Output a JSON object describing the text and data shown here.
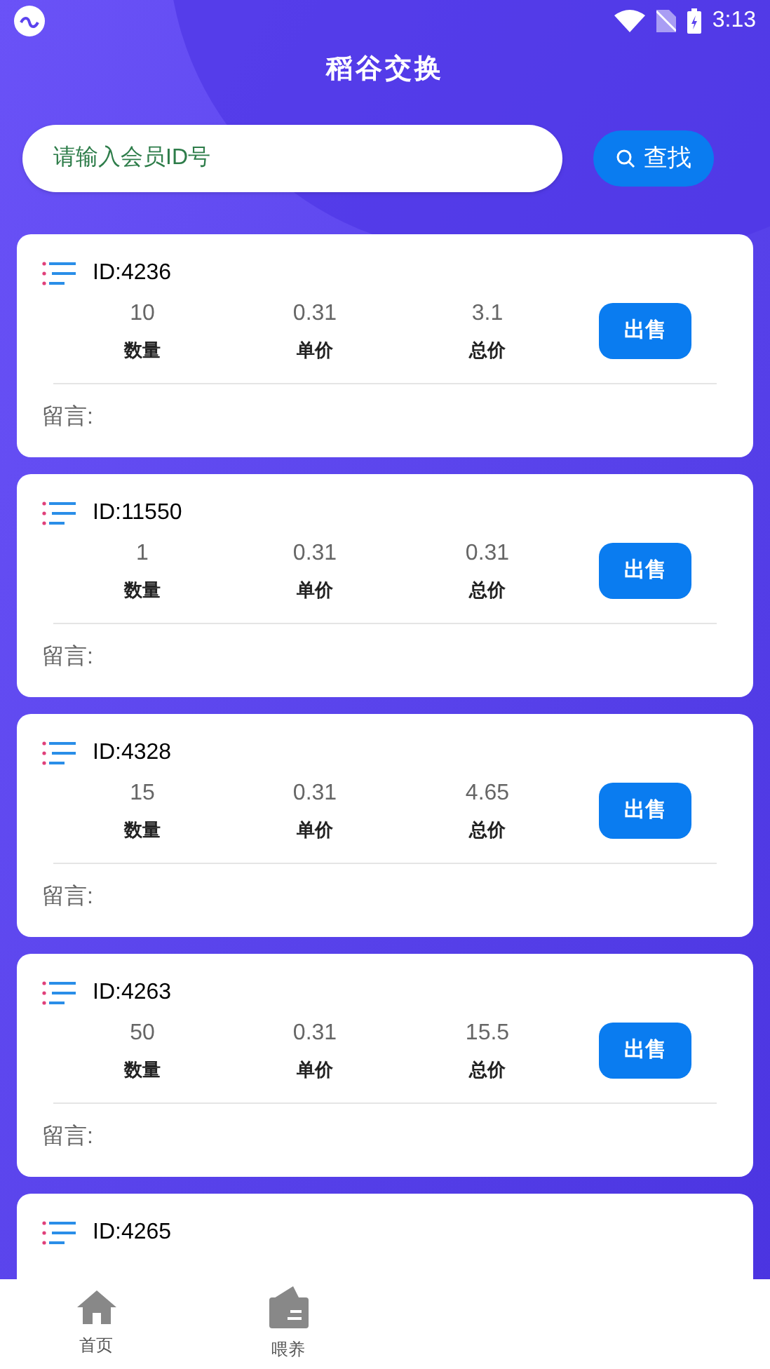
{
  "status_bar": {
    "time": "3:13"
  },
  "title": "稻谷交换",
  "search": {
    "placeholder": "请输入会员ID号",
    "button": "查找"
  },
  "orders": [
    {
      "id": "ID:4236",
      "quantity": "10",
      "unit_price": "0.31",
      "total": "3.1",
      "quantity_label": "数量",
      "unit_price_label": "单价",
      "total_label": "总价",
      "action": "出售",
      "message_label": "留言:"
    },
    {
      "id": "ID:11550",
      "quantity": "1",
      "unit_price": "0.31",
      "total": "0.31",
      "quantity_label": "数量",
      "unit_price_label": "单价",
      "total_label": "总价",
      "action": "出售",
      "message_label": "留言:"
    },
    {
      "id": "ID:4328",
      "quantity": "15",
      "unit_price": "0.31",
      "total": "4.65",
      "quantity_label": "数量",
      "unit_price_label": "单价",
      "total_label": "总价",
      "action": "出售",
      "message_label": "留言:"
    },
    {
      "id": "ID:4263",
      "quantity": "50",
      "unit_price": "0.31",
      "total": "15.5",
      "quantity_label": "数量",
      "unit_price_label": "单价",
      "total_label": "总价",
      "action": "出售",
      "message_label": "留言:"
    },
    {
      "id": "ID:4265"
    }
  ],
  "bottom_nav": [
    {
      "label": "首页",
      "kind": "home"
    },
    {
      "label": "喂养",
      "kind": "wallet"
    }
  ]
}
